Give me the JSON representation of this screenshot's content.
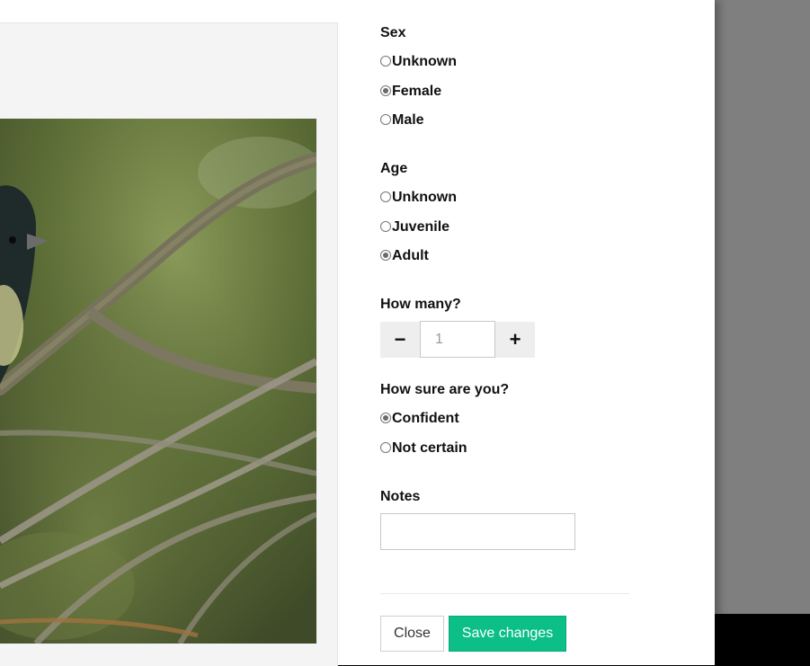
{
  "sex": {
    "heading": "Sex",
    "options": [
      {
        "label": "Unknown",
        "checked": false
      },
      {
        "label": "Female",
        "checked": true
      },
      {
        "label": "Male",
        "checked": false
      }
    ]
  },
  "age": {
    "heading": "Age",
    "options": [
      {
        "label": "Unknown",
        "checked": false
      },
      {
        "label": "Juvenile",
        "checked": false
      },
      {
        "label": "Adult",
        "checked": true
      }
    ]
  },
  "count": {
    "heading": "How many?",
    "minus_label": "−",
    "plus_label": "+",
    "value": "1"
  },
  "certainty": {
    "heading": "How sure are you?",
    "options": [
      {
        "label": "Confident",
        "checked": true
      },
      {
        "label": "Not certain",
        "checked": false
      }
    ]
  },
  "notes": {
    "heading": "Notes",
    "value": ""
  },
  "footer": {
    "close_label": "Close",
    "save_label": "Save changes"
  },
  "colors": {
    "save_button": "#0bbf87",
    "backdrop": "#7f7f7f"
  }
}
